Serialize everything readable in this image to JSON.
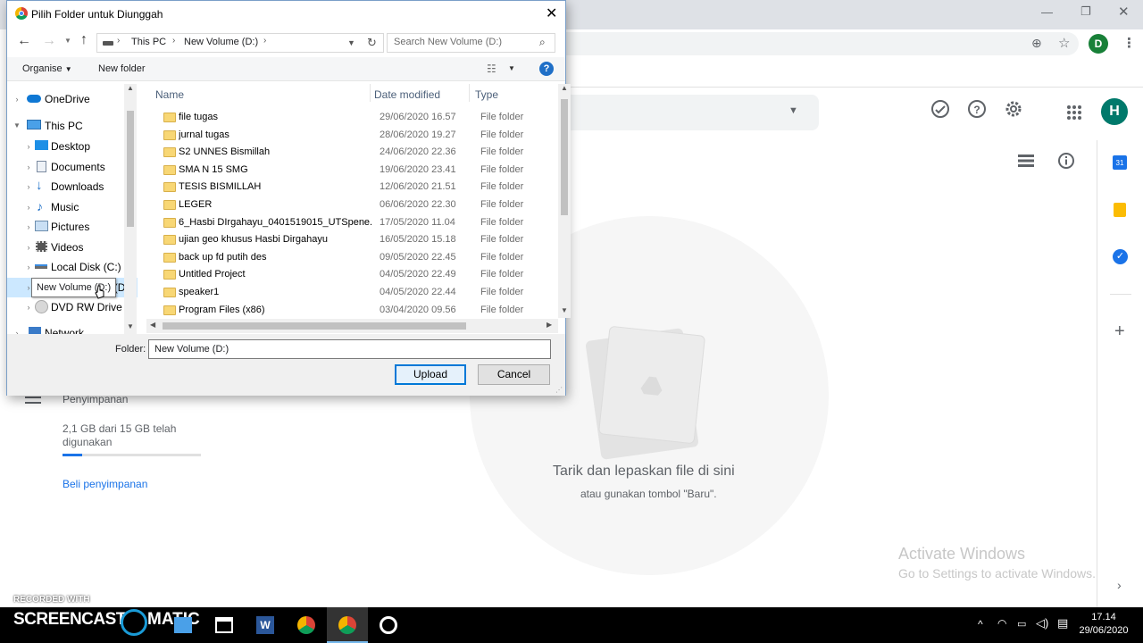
{
  "dialog": {
    "title": "Pilih Folder untuk Diunggah",
    "breadcrumb": [
      "This PC",
      "New Volume (D:)"
    ],
    "search_placeholder": "Search New Volume (D:)",
    "organise_label": "Organise",
    "new_folder_label": "New folder",
    "nav_items": [
      {
        "label": "OneDrive",
        "icon": "cloud-icon"
      },
      {
        "label": "This PC",
        "icon": "computer-icon"
      },
      {
        "label": "Desktop",
        "icon": "desktop-icon"
      },
      {
        "label": "Documents",
        "icon": "documents-icon"
      },
      {
        "label": "Downloads",
        "icon": "download-icon"
      },
      {
        "label": "Music",
        "icon": "music-icon"
      },
      {
        "label": "Pictures",
        "icon": "pictures-icon"
      },
      {
        "label": "Videos",
        "icon": "videos-icon"
      },
      {
        "label": "Local Disk (C:)",
        "icon": "drive-icon"
      },
      {
        "label": "New Volume (D:)",
        "icon": "drive-icon"
      },
      {
        "label": "DVD RW Drive (F",
        "icon": "dvd-icon"
      },
      {
        "label": "Network",
        "icon": "network-icon"
      }
    ],
    "columns": {
      "name": "Name",
      "date": "Date modified",
      "type": "Type"
    },
    "files": [
      {
        "name": "file tugas",
        "date": "29/06/2020 16.57",
        "type": "File folder"
      },
      {
        "name": "jurnal tugas",
        "date": "28/06/2020 19.27",
        "type": "File folder"
      },
      {
        "name": "S2 UNNES Bismillah",
        "date": "24/06/2020 22.36",
        "type": "File folder"
      },
      {
        "name": "SMA N 15 SMG",
        "date": "19/06/2020 23.41",
        "type": "File folder"
      },
      {
        "name": "TESIS BISMILLAH",
        "date": "12/06/2020 21.51",
        "type": "File folder"
      },
      {
        "name": "LEGER",
        "date": "06/06/2020 22.30",
        "type": "File folder"
      },
      {
        "name": "6_Hasbi DIrgahayu_0401519015_UTSpene...",
        "date": "17/05/2020 11.04",
        "type": "File folder"
      },
      {
        "name": "ujian geo khusus Hasbi Dirgahayu",
        "date": "16/05/2020 15.18",
        "type": "File folder"
      },
      {
        "name": "back up fd putih des",
        "date": "09/05/2020 22.45",
        "type": "File folder"
      },
      {
        "name": "Untitled Project",
        "date": "04/05/2020 22.49",
        "type": "File folder"
      },
      {
        "name": "speaker1",
        "date": "04/05/2020 22.44",
        "type": "File folder"
      },
      {
        "name": "Program Files (x86)",
        "date": "03/04/2020 09.56",
        "type": "File folder"
      }
    ],
    "folder_label": "Folder:",
    "folder_value": "New Volume (D:)",
    "upload_label": "Upload",
    "cancel_label": "Cancel",
    "tooltip": "New Volume (D:)"
  },
  "chrome": {
    "profile_initial": "D",
    "account_initial": "H"
  },
  "drive": {
    "storage_label": "Penyimpanan",
    "storage_usage": "2,1 GB dari 15 GB telah digunakan",
    "storage_fraction": 0.14,
    "buy_storage": "Beli penyimpanan",
    "drop_title": "Tarik dan lepaskan file di sini",
    "drop_subtitle": "atau gunakan tombol \"Baru\".",
    "activate_title": "Activate Windows",
    "activate_subtitle": "Go to Settings to activate Windows."
  },
  "watermark": {
    "recorded_with": "RECORDED WITH",
    "brand_left": "SCREENCAST",
    "brand_right": "MATIC"
  },
  "taskbar": {
    "time": "17.14",
    "date": "29/06/2020"
  },
  "colors": {
    "accent_blue": "#1a73e8",
    "avatar_green": "#188038",
    "avatar_teal": "#00796b",
    "upload_border": "#0078d7"
  }
}
